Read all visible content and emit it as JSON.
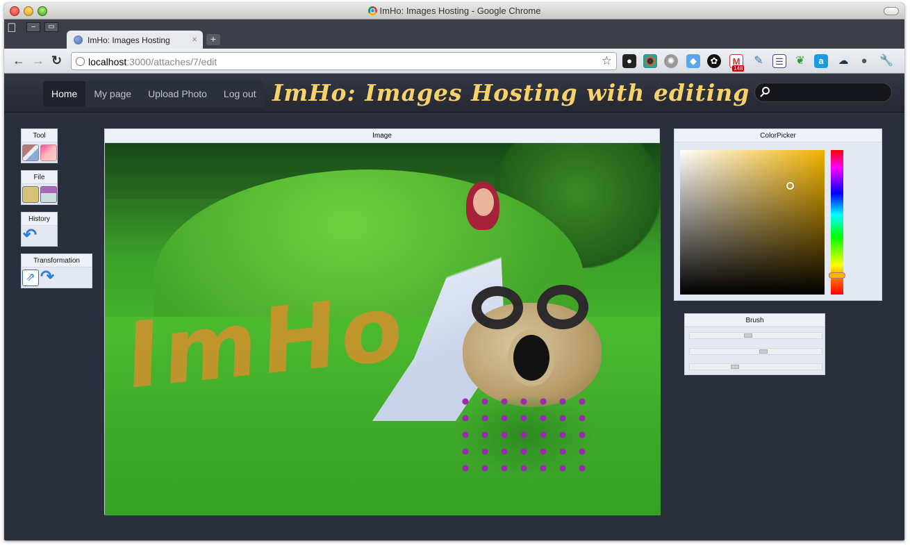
{
  "window": {
    "title": "ImHo: Images Hosting - Google Chrome"
  },
  "tab": {
    "title": "ImHo: Images Hosting",
    "close": "×",
    "new_tab": "+"
  },
  "address": {
    "host": "localhost",
    "path": ":3000/attaches/7/edit"
  },
  "extensions": {
    "badge": "148"
  },
  "site": {
    "menu": [
      "Home",
      "My page",
      "Upload Photo",
      "Log out"
    ],
    "active": "Home",
    "brand": "ImHo: Images Hosting with editing",
    "search_value": ""
  },
  "panels": {
    "tool": "Tool",
    "file": "File",
    "history": "History",
    "transformation": "Transformation",
    "image": "Image",
    "colorpicker": "ColorPicker",
    "brush": "Brush"
  },
  "canvas_text": "ImHo",
  "colorpicker": {
    "hue_color": "#f2b200",
    "selected_color": "#f5c13a"
  },
  "brush": {
    "slider_values": [
      0.44,
      0.56,
      0.33
    ]
  },
  "icons": {
    "tool": [
      "brush-icon",
      "eraser-icon"
    ],
    "file": [
      "open-file-icon",
      "save-icon"
    ],
    "history": [
      "undo-icon"
    ],
    "transformation": [
      "resize-icon",
      "rotate-icon"
    ]
  }
}
